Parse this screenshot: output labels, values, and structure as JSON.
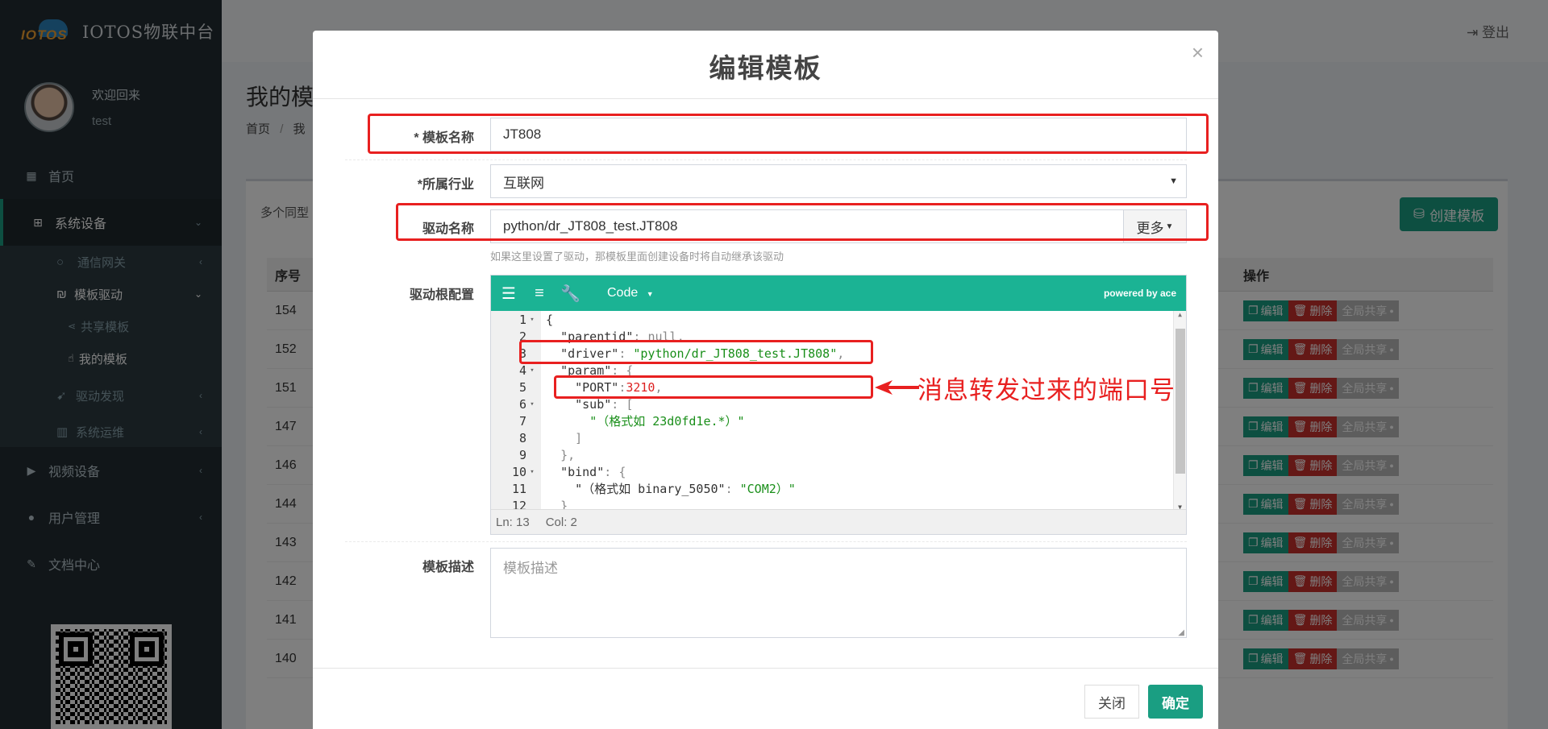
{
  "app": {
    "logo_text": "IOTOS",
    "title": "IOTOS物联中台"
  },
  "user": {
    "welcome": "欢迎回来",
    "name": "test"
  },
  "sidebar": {
    "home": "首页",
    "system_device": "系统设备",
    "gateway": "通信网关",
    "template_driver": "模板驱动",
    "shared_template": "共享模板",
    "my_template": "我的模板",
    "driver_discovery": "驱动发现",
    "system_ops": "系统运维",
    "video_device": "视频设备",
    "user_mgmt": "用户管理",
    "doc_center": "文档中心"
  },
  "topbar": {
    "logout": "登出"
  },
  "page": {
    "title": "我的模",
    "crumb_home": "首页",
    "crumb_sep": "/",
    "crumb_cur": "我",
    "hint": "多个同型",
    "create_btn": "创建模板",
    "col_id": "序号",
    "col_op": "操作",
    "op_edit": "编辑",
    "op_delete": "删除",
    "op_share": "全局共享",
    "rows": [
      "154",
      "152",
      "151",
      "147",
      "146",
      "144",
      "143",
      "142",
      "141",
      "140"
    ]
  },
  "modal": {
    "title": "编辑模板",
    "close_x": "×",
    "name_label": "* 模板名称",
    "name_value": "JT808",
    "industry_label": "*所属行业",
    "industry_value": "互联网",
    "driver_label": "驱动名称",
    "driver_value": "python/dr_JT808_test.JT808",
    "more_btn": "更多",
    "driver_help": "如果这里设置了驱动，那模板里面创建设备时将自动继承该驱动",
    "config_label": "驱动根配置",
    "editor_mode": "Code",
    "powered": "powered by ace",
    "status_ln": "Ln: 13",
    "status_col": "Col: 2",
    "desc_label": "模板描述",
    "desc_placeholder": "模板描述",
    "btn_close": "关闭",
    "btn_ok": "确定"
  },
  "code": {
    "l1": "{",
    "l2_key": "\"parentid\"",
    "l2_val": "null",
    "l3_key": "\"driver\"",
    "l3_val": "\"python/dr_JT808_test.JT808\"",
    "l4_key": "\"param\"",
    "l4_val": "{",
    "l5_key": "\"PORT\"",
    "l5_val": "3210",
    "l6_key": "\"sub\"",
    "l6_val": "[",
    "l7_val": "\"（格式如 23d0fd1e.*）\"",
    "l8": "]",
    "l9": "},",
    "l10_key": "\"bind\"",
    "l10_val": "{",
    "l11_key": "\"（格式如 binary_5050\"",
    "l11_val": "\"COM2）\"",
    "l12": "}"
  },
  "annotation": {
    "port_note": "消息转发过来的端口号"
  }
}
